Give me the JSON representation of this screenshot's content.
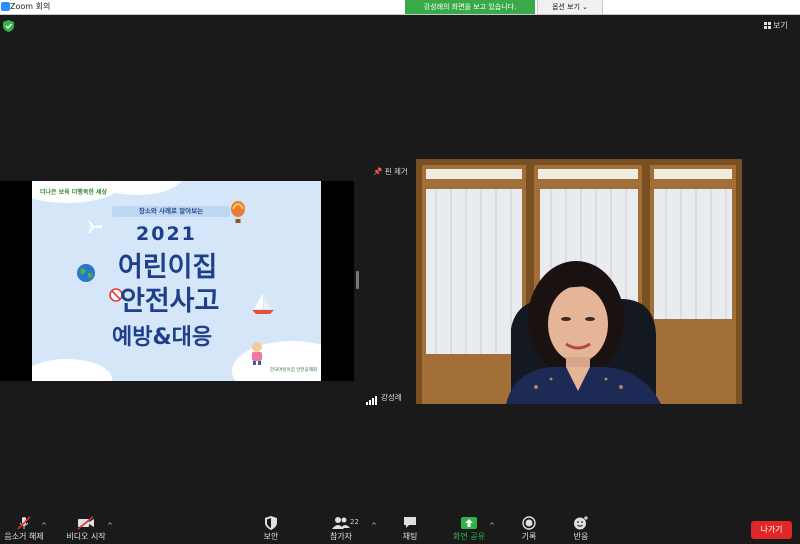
{
  "window": {
    "title": "Zoom 회의"
  },
  "banner": {
    "sharing_text": "강성례의 화면을 보고 있습니다.",
    "view_options": "옵션 보기 ⌄"
  },
  "top_right": {
    "view_label": "보기"
  },
  "pinned": {
    "remove_pin_label": "핀 제거"
  },
  "slide": {
    "brand_text": "더나은 보육 더행복한 세상",
    "subtitle": "장소와 사례로 알아보는",
    "year": "2021",
    "line1": "어린이집",
    "line2": "안전사고",
    "line3": "예방&대응",
    "footer": "한국어린이집 안전공제회"
  },
  "participant": {
    "name": "강성례"
  },
  "toolbar": {
    "unmute": "음소거 해제",
    "start_video": "비디오 시작",
    "security": "보안",
    "participants": "참가자",
    "participant_count": "22",
    "chat": "채팅",
    "share_screen": "화면 공유",
    "record": "기록",
    "reactions": "반응",
    "leave": "나가기"
  },
  "colors": {
    "background": "#1a1a1a",
    "share_banner": "#3aa94a",
    "leave_button": "#e02828",
    "share_icon": "#2fb34a",
    "slide_text": "#1e3f8a"
  }
}
